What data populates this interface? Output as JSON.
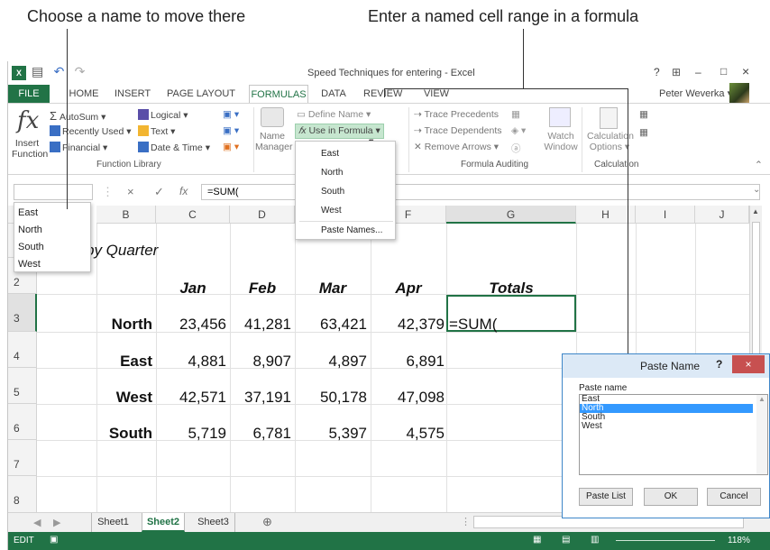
{
  "callouts": {
    "left": "Choose a name to move there",
    "right": "Enter a named cell range in a formula"
  },
  "window": {
    "title": "Speed Techniques for entering - Excel",
    "user": "Peter Weverka",
    "title_controls": [
      "?",
      "–",
      "□",
      "×"
    ]
  },
  "tabs": [
    "FILE",
    "HOME",
    "INSERT",
    "PAGE LAYOUT",
    "FORMULAS",
    "DATA",
    "REVIEW",
    "VIEW"
  ],
  "ribbon": {
    "insert_function": {
      "icon": "fx",
      "line1": "Insert",
      "line2": "Function"
    },
    "autosum": "AutoSum",
    "recently_used": "Recently Used",
    "financial": "Financial",
    "logical": "Logical",
    "text": "Text",
    "date_time": "Date & Time",
    "group_function_library": "Function Library",
    "name_manager_1": "Name",
    "name_manager_2": "Manager",
    "define_name": "Define Name",
    "use_in_formula": "Use in Formula",
    "trace_precedents": "Trace Precedents",
    "trace_dependents": "Trace Dependents",
    "remove_arrows": "Remove Arrows",
    "watch_1": "Watch",
    "watch_2": "Window",
    "group_formula_auditing": "Formula Auditing",
    "calc_options_1": "Calculation",
    "calc_options_2": "Options",
    "group_calculation": "Calculation"
  },
  "formula_bar": {
    "namebox_value": "",
    "fx": "fx",
    "cancel": "×",
    "enter": "✓",
    "content": "=SUM("
  },
  "namebox_dropdown": [
    "East",
    "North",
    "South",
    "West"
  ],
  "use_in_formula_menu": {
    "items": [
      "East",
      "North",
      "South",
      "West"
    ],
    "paste_names": "Paste Names..."
  },
  "columns": [
    "B",
    "C",
    "D",
    "E",
    "F",
    "G",
    "H",
    "I",
    "J"
  ],
  "rows": [
    "1",
    "2",
    "3",
    "4",
    "5",
    "6",
    "7",
    "8"
  ],
  "sheet": {
    "title_fragment": "by Quarter",
    "headers": [
      "Jan",
      "Feb",
      "Mar",
      "Apr",
      "Totals"
    ],
    "data": [
      {
        "label": "North",
        "values": [
          "23,456",
          "41,281",
          "63,421",
          "42,379"
        ],
        "total": "=SUM("
      },
      {
        "label": "East",
        "values": [
          "4,881",
          "8,907",
          "4,897",
          "6,891"
        ],
        "total": ""
      },
      {
        "label": "West",
        "values": [
          "42,571",
          "37,191",
          "50,178",
          "47,098"
        ],
        "total": ""
      },
      {
        "label": "South",
        "values": [
          "5,719",
          "6,781",
          "5,397",
          "4,575"
        ],
        "total": ""
      }
    ]
  },
  "sheet_tabs": [
    "Sheet1",
    "Sheet2",
    "Sheet3"
  ],
  "active_sheet": "Sheet2",
  "status": {
    "mode": "EDIT",
    "zoom": "118%"
  },
  "dialog": {
    "title": "Paste Name",
    "label": "Paste name",
    "items": [
      "East",
      "North",
      "South",
      "West"
    ],
    "selected": "North",
    "paste_list": "Paste List",
    "ok": "OK",
    "cancel": "Cancel"
  },
  "colors": {
    "accent": "#217346",
    "selection": "#3399ff",
    "dialog_close": "#c75050"
  }
}
